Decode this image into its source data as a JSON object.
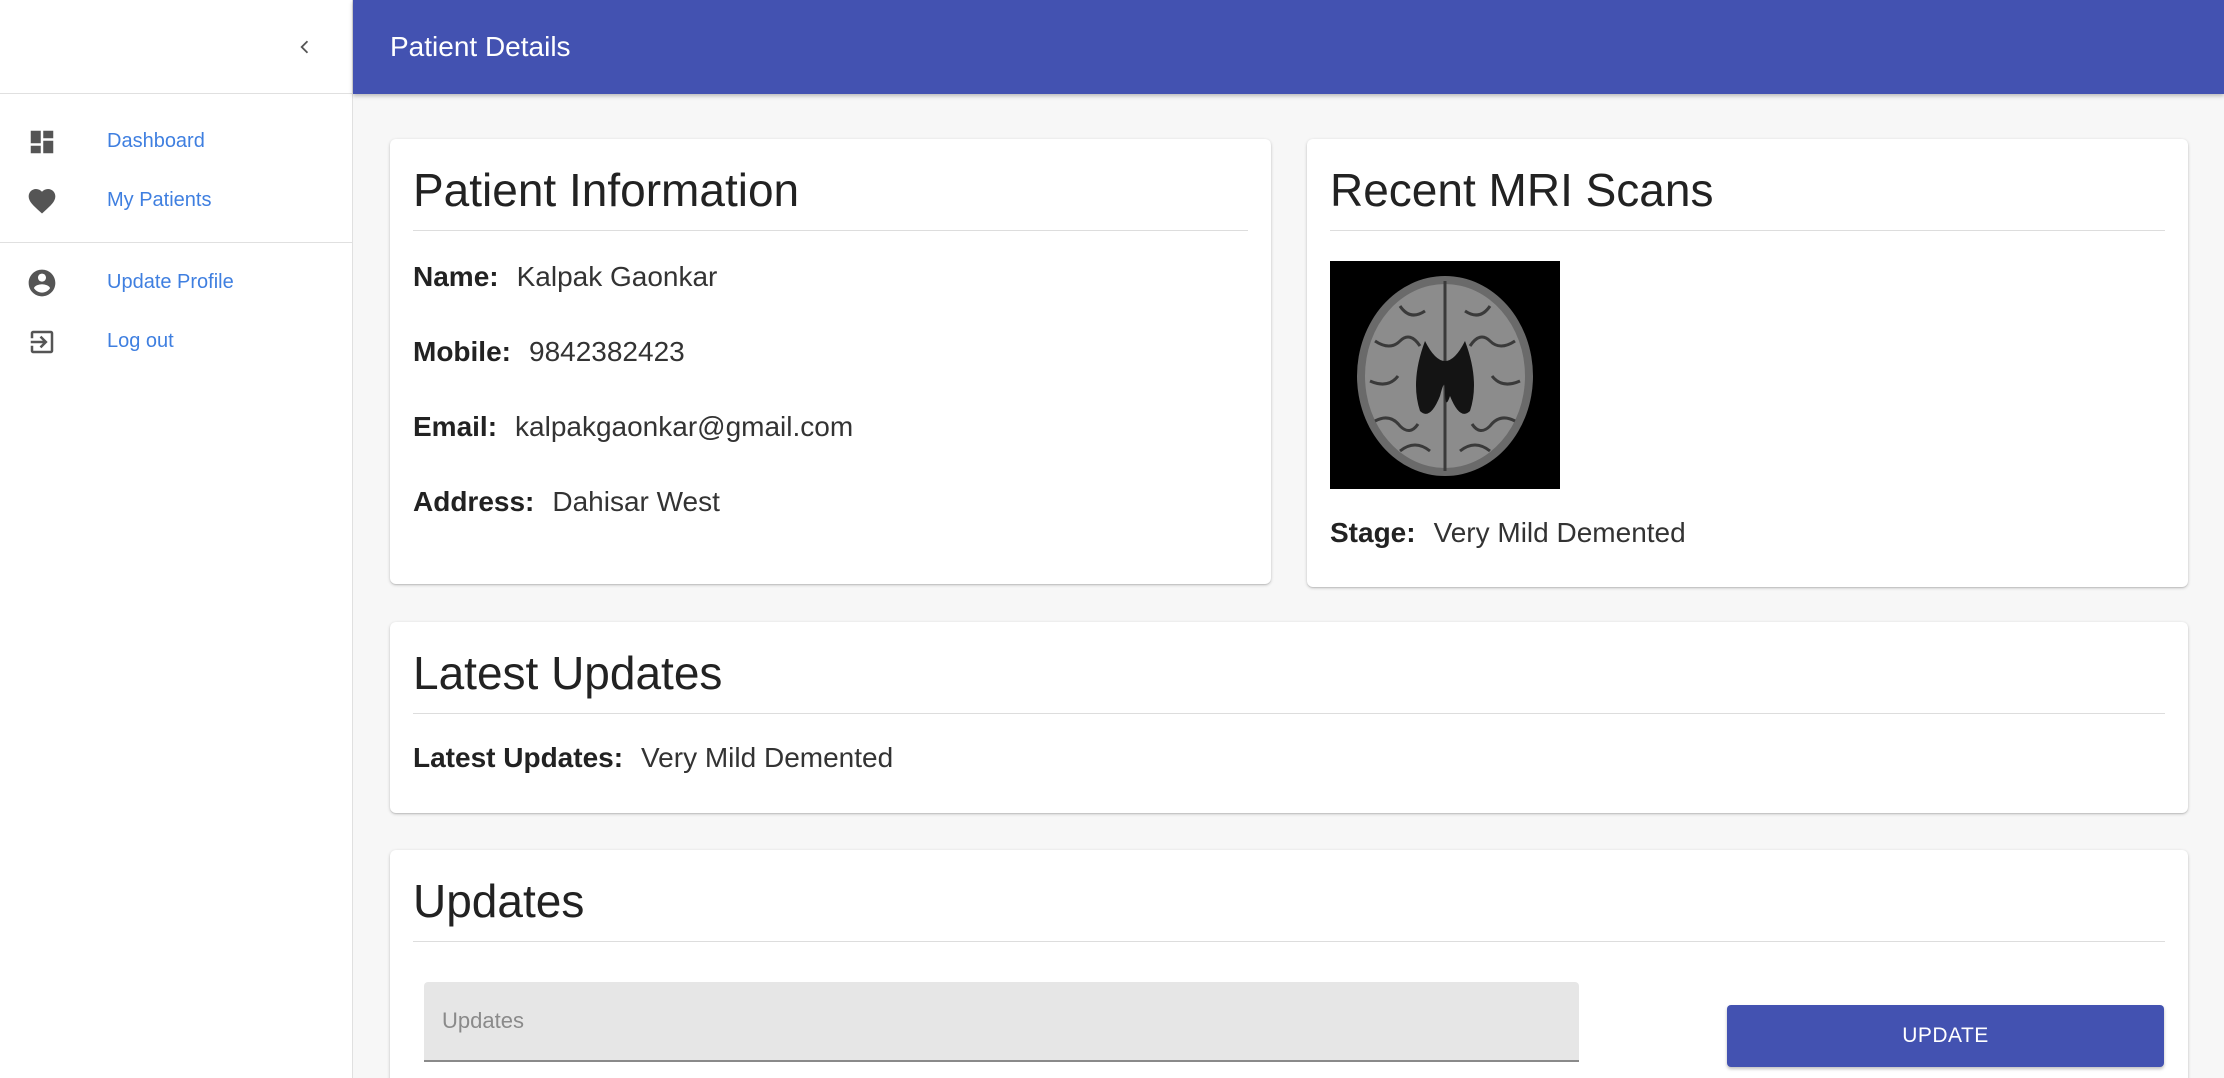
{
  "appbar": {
    "title": "Patient Details"
  },
  "sidebar": {
    "collapse_icon": "chevron-left-icon",
    "items": [
      {
        "label": "Dashboard",
        "icon": "dashboard-icon"
      },
      {
        "label": "My Patients",
        "icon": "heart-icon"
      },
      {
        "label": "Update Profile",
        "icon": "account-circle-icon"
      },
      {
        "label": "Log out",
        "icon": "logout-icon"
      }
    ]
  },
  "patient_info": {
    "title": "Patient Information",
    "name_label": "Name:",
    "name": "Kalpak Gaonkar",
    "mobile_label": "Mobile:",
    "mobile": "9842382423",
    "email_label": "Email:",
    "email": "kalpakgaonkar@gmail.com",
    "address_label": "Address:",
    "address": "Dahisar West"
  },
  "mri": {
    "title": "Recent MRI Scans",
    "stage_label": "Stage:",
    "stage": "Very Mild Demented"
  },
  "latest_updates": {
    "title": "Latest Updates",
    "label": "Latest Updates:",
    "value": "Very Mild Demented"
  },
  "updates": {
    "title": "Updates",
    "input_placeholder": "Updates",
    "input_value": "",
    "button_label": "UPDATE"
  },
  "colors": {
    "primary": "#4352b1",
    "link": "#3f7fe0",
    "icon": "#555555"
  }
}
